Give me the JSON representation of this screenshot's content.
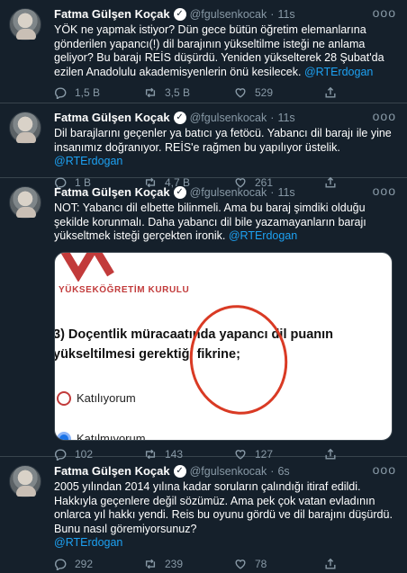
{
  "tweets": [
    {
      "name": "Fatma Gülşen Koçak",
      "handle": "@fgulsenkocak",
      "time": "11s",
      "text": "YÖK ne yapmak istiyor? Dün gece bütün öğretim elemanlarına gönderilen yapancı(!) dil barajının yükseltilme isteği ne anlama geliyor? Bu barajı REİS düşürdü. Yeniden yükselterek 28 Şubat'da ezilen Anadolulu akademisyenlerin önü kesilecek.",
      "mention": "@RTErdogan",
      "replies": "1,5 B",
      "retweets": "3,5 B",
      "likes": "529"
    },
    {
      "name": "Fatma Gülşen Koçak",
      "handle": "@fgulsenkocak",
      "time": "11s",
      "text": "Dil barajlarını geçenler ya batıcı ya fetöcü. Yabancı dil barajı ile yine insanımız doğranıyor. REİS'e rağmen bu yapılıyor üstelik.",
      "mention": "@RTErdogan",
      "replies": "1 B",
      "retweets": "4,7 B",
      "likes": "261"
    },
    {
      "name": "Fatma Gülşen Koçak",
      "handle": "@fgulsenkocak",
      "time": "11s",
      "text": "NOT: Yabancı dil elbette bilinmeli. Ama bu baraj şimdiki olduğu şekilde korunmalı. Daha yabancı dil bile yazamayanların barajı yükseltmek isteği gerçekten ironik.",
      "mention": "@RTErdogan",
      "replies": "102",
      "retweets": "143",
      "likes": "127",
      "media": {
        "logo_text": "YÜKSEKÖĞRETİM KURULU",
        "question": "3) Doçentlik müracaatında yapancı dil puanın yükseltilmesi gerektiği fikrine;",
        "option1": "Katılıyorum",
        "option2": "Katılmıyorum",
        "accent": "#c23b3b",
        "circle_color": "#d93a24"
      }
    },
    {
      "name": "Fatma Gülşen Koçak",
      "handle": "@fgulsenkocak",
      "time": "6s",
      "text": "2005 yılından 2014 yılına kadar soruların çalındığı itiraf edildi. Hakkıyla geçenlere değil sözümüz. Ama pek çok vatan evladının onlarca yıl hakkı yendi. Reis bu oyunu gördü ve dil barajını düşürdü. Bunu nasıl göremiyorsunuz?",
      "mention": "@RTErdogan",
      "replies": "292",
      "retweets": "239",
      "likes": "78"
    }
  ],
  "icons": {
    "verified": "verified-badge-icon",
    "more": "more-icon",
    "reply": "reply-icon",
    "retweet": "retweet-icon",
    "like": "heart-icon",
    "share": "share-icon"
  },
  "colors": {
    "background": "#15202b",
    "link": "#1da1f2",
    "muted": "#8899a6",
    "divider": "#38444d"
  }
}
